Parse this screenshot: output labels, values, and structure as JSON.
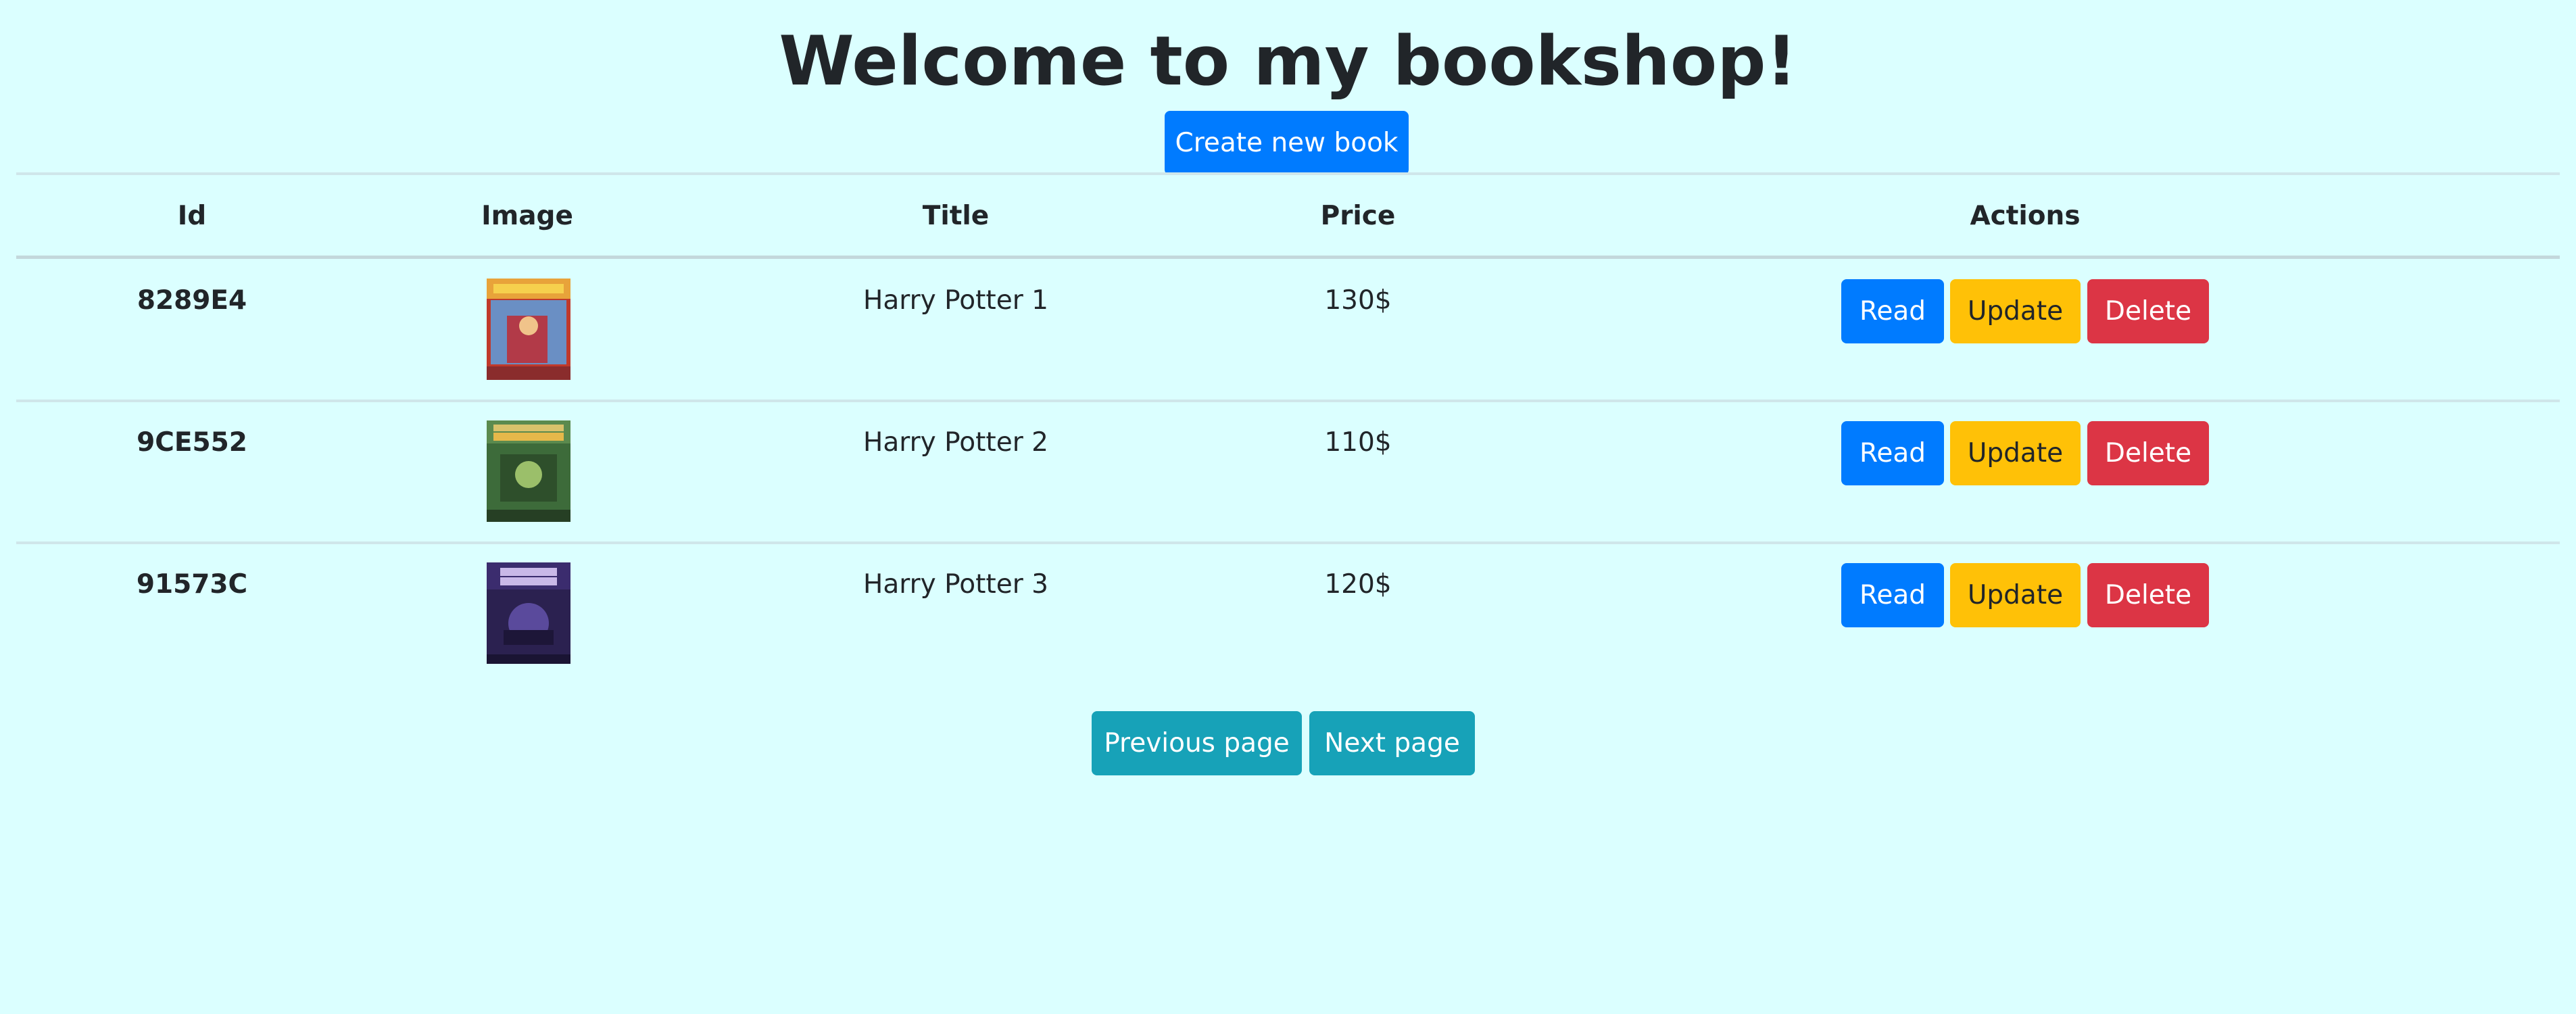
{
  "header": {
    "title": "Welcome to my bookshop!",
    "create_label": "Create new book"
  },
  "table": {
    "columns": [
      "Id",
      "Image",
      "Title",
      "Price",
      "Actions"
    ],
    "rows": [
      {
        "id": "8289E4",
        "title": "Harry Potter 1",
        "price": "130$",
        "cover_icon": "harry-potter-1-cover"
      },
      {
        "id": "9CE552",
        "title": "Harry Potter 2",
        "price": "110$",
        "cover_icon": "harry-potter-2-cover"
      },
      {
        "id": "91573C",
        "title": "Harry Potter 3",
        "price": "120$",
        "cover_icon": "harry-potter-3-cover"
      }
    ],
    "actions": {
      "read": "Read",
      "update": "Update",
      "delete": "Delete"
    }
  },
  "pagination": {
    "previous_label": "Previous page",
    "next_label": "Next page"
  },
  "colors": {
    "background": "#dbffff",
    "primary": "#007bff",
    "warning": "#ffc107",
    "danger": "#dc3545",
    "info": "#17a2b8"
  }
}
